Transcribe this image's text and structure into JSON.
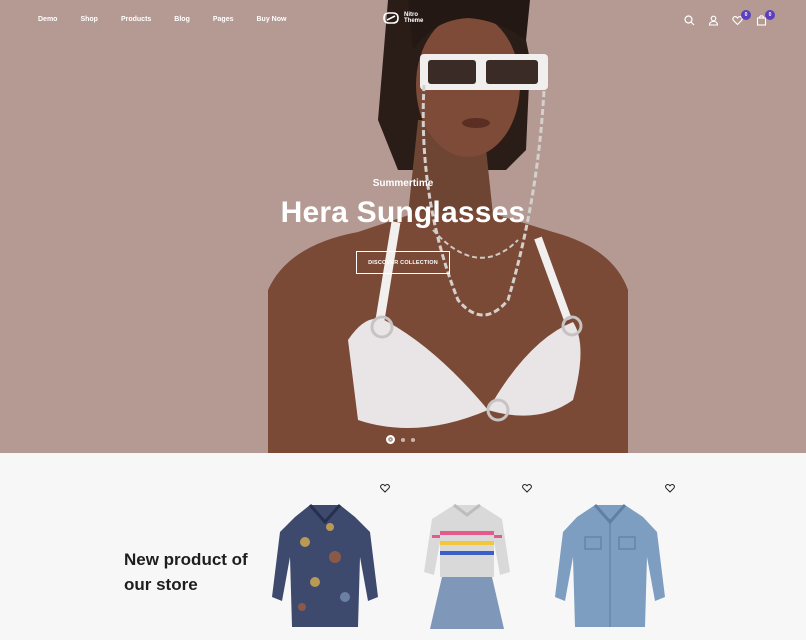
{
  "nav": {
    "links": [
      "Demo",
      "Shop",
      "Products",
      "Blog",
      "Pages",
      "Buy Now"
    ],
    "logo_line1": "Nitro",
    "logo_line2": "Theme",
    "wishlist_count": "0",
    "cart_count": "0"
  },
  "hero": {
    "subtitle": "Summertime",
    "title": "Hera Sunglasses",
    "button_label": "DISCOVER COLLECTION",
    "slide_count": 3,
    "active_slide": 1
  },
  "products_section": {
    "title_line1": "New product of",
    "title_line2": "our store",
    "products": [
      {
        "icon": "paisley-shirt"
      },
      {
        "icon": "striped-sweater-dress"
      },
      {
        "icon": "denim-shirt"
      }
    ]
  },
  "colors": {
    "hero_bg": "#b49a93",
    "badge": "#5b3fbf",
    "section_bg": "#f7f7f7"
  }
}
